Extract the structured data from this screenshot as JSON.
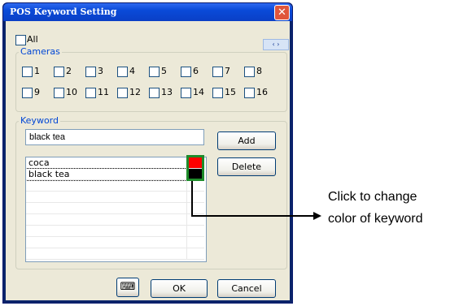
{
  "window": {
    "title": "POS Keyword Setting",
    "close_glyph": "✕"
  },
  "all_checkbox": {
    "label": "All",
    "checked": false
  },
  "scroll_arrows": {
    "glyph": "‹ ›"
  },
  "cameras": {
    "legend": "Cameras",
    "items": [
      {
        "label": "1"
      },
      {
        "label": "2"
      },
      {
        "label": "3"
      },
      {
        "label": "4"
      },
      {
        "label": "5"
      },
      {
        "label": "6"
      },
      {
        "label": "7"
      },
      {
        "label": "8"
      },
      {
        "label": "9"
      },
      {
        "label": "10"
      },
      {
        "label": "11"
      },
      {
        "label": "12"
      },
      {
        "label": "13"
      },
      {
        "label": "14"
      },
      {
        "label": "15"
      },
      {
        "label": "16"
      }
    ]
  },
  "keyword": {
    "legend": "Keyword",
    "input_value": "black tea",
    "add_label": "Add",
    "delete_label": "Delete",
    "list": [
      {
        "text": "coca",
        "color": "#ff0000"
      },
      {
        "text": "black tea",
        "color": "#000000"
      }
    ]
  },
  "footer": {
    "ok_label": "OK",
    "cancel_label": "Cancel",
    "keyboard_icon": "keyboard-icon"
  },
  "callout": {
    "line1": "Click to change",
    "line2": "color of keyword"
  },
  "colors": {
    "highlight_border": "#1e8c2a",
    "arrow": "#000000"
  }
}
